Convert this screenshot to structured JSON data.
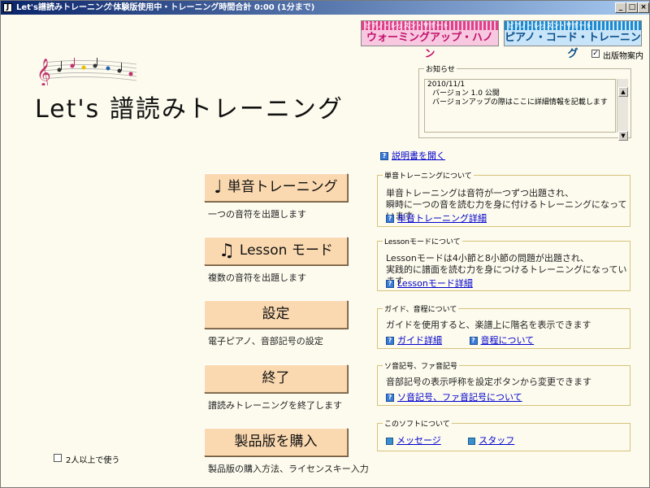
{
  "titlebar": {
    "title": "Let's譜読みトレーニング",
    "trial_status": "♪体験版使用中・トレーニング時間合計 0:00 (1分まで)",
    "app_icon": "J",
    "min": "_",
    "max": "□",
    "close": "×"
  },
  "banners": {
    "hanon": {
      "sub": "ピアノ・レッスン・サポート",
      "label": "ウォーミングアップ・ハノン"
    },
    "chord": {
      "sub": "ピアノ・レッスン・サポート",
      "label": "ピアノ・コード・トレーニング"
    }
  },
  "publication": {
    "label": "出版物案内",
    "checked": "✓"
  },
  "logo": {
    "title": "Let's 譜読みトレーニング"
  },
  "notice": {
    "legend": "お知らせ",
    "lines": [
      "2010/11/1",
      "バージョン 1.0 公開",
      "バージョンアップの際はここに詳細情報を記載します"
    ],
    "up": "▲",
    "down": "▼"
  },
  "manual_link": "説明書を開く",
  "help_glyph": "?",
  "buttons": [
    {
      "label": "単音トレーニング",
      "icon": "♩",
      "desc": "一つの音符を出題します"
    },
    {
      "label": "Lesson モード",
      "icon": "♫",
      "desc": "複数の音符を出題します"
    },
    {
      "label": "設定",
      "desc": "電子ピアノ、音部記号の設定"
    },
    {
      "label": "終了",
      "desc": "譜読みトレーニングを終了します"
    },
    {
      "label": "製品版を購入",
      "desc": "製品版の購入方法、ライセンスキー入力"
    }
  ],
  "groups": {
    "single": {
      "legend": "単音トレーニングについて",
      "desc1": "単音トレーニングは音符が一つずつ出題され、",
      "desc2": "瞬時に一つの音を読む力を身に付けるトレーニングになっています",
      "link": "単音トレーニング詳細"
    },
    "lesson": {
      "legend": "Lessonモードについて",
      "desc1": "Lessonモードは4小節と8小節の問題が出題され、",
      "desc2": "実践的に譜面を読む力を身につけるトレーニングになっています",
      "link": "Lessonモード詳細"
    },
    "guide": {
      "legend": "ガイド、音程について",
      "desc1": "ガイドを使用すると、楽譜上に階名を表示できます",
      "link1": "ガイド詳細",
      "link2": "音程について"
    },
    "clef": {
      "legend": "ソ音記号、ファ音記号",
      "desc1": "音部記号の表示呼称を設定ボタンから変更できます",
      "link": "ソ音記号、ファ音記号について"
    },
    "about": {
      "legend": "このソフトについて",
      "link1": "メッセージ",
      "link2": "スタッフ"
    }
  },
  "multi_user": {
    "label": "2人以上で使う",
    "checked": ""
  }
}
